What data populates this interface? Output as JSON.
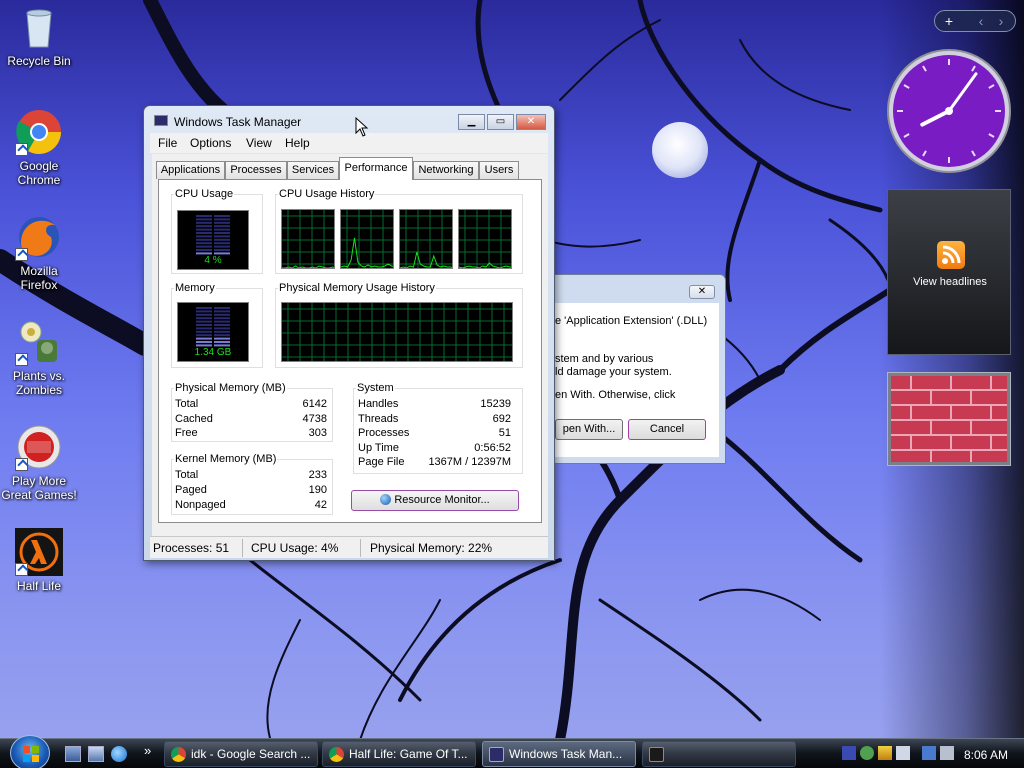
{
  "desktop": {
    "icons": [
      {
        "label": "Recycle Bin",
        "icon": "recycle-bin-icon"
      },
      {
        "label": "Google Chrome",
        "icon": "chrome-icon"
      },
      {
        "label": "Mozilla Firefox",
        "icon": "firefox-icon"
      },
      {
        "label": "Plants vs. Zombies",
        "icon": "plants-vs-zombies-icon"
      },
      {
        "label": "Play More Great Games!",
        "icon": "popcap-icon"
      },
      {
        "label": "Half Life",
        "icon": "half-life-icon"
      }
    ]
  },
  "sidebar": {
    "add_button": "+",
    "feed_label": "View headlines",
    "clock": {
      "hour": 8,
      "minute": 6
    }
  },
  "dialog": {
    "close_label": "✕",
    "line1": "e 'Application Extension' (.DLL)",
    "line2": "stem and by various",
    "line3": "ld damage your system.",
    "line4": "en With. Otherwise, click",
    "open_with_label": "pen With...",
    "cancel_label": "Cancel"
  },
  "task_manager": {
    "title": "Windows Task Manager",
    "window_buttons": {
      "minimize": "▁",
      "maximize": "▭",
      "close": "✕"
    },
    "menu": [
      "File",
      "Options",
      "View",
      "Help"
    ],
    "tabs": [
      "Applications",
      "Processes",
      "Services",
      "Performance",
      "Networking",
      "Users"
    ],
    "active_tab": "Performance",
    "cpu_usage_label": "CPU Usage",
    "cpu_usage_value": "4 %",
    "cpu_usage_pct": 4,
    "cpu_history_label": "CPU Usage History",
    "memory_label": "Memory",
    "memory_value": "1.34 GB",
    "memory_pct": 22,
    "memory_history_label": "Physical Memory Usage History",
    "physical_memory": {
      "title": "Physical Memory (MB)",
      "rows": [
        {
          "label": "Total",
          "value": "6142"
        },
        {
          "label": "Cached",
          "value": "4738"
        },
        {
          "label": "Free",
          "value": "303"
        }
      ]
    },
    "kernel_memory": {
      "title": "Kernel Memory (MB)",
      "rows": [
        {
          "label": "Total",
          "value": "233"
        },
        {
          "label": "Paged",
          "value": "190"
        },
        {
          "label": "Nonpaged",
          "value": "42"
        }
      ]
    },
    "system": {
      "title": "System",
      "rows": [
        {
          "label": "Handles",
          "value": "15239"
        },
        {
          "label": "Threads",
          "value": "692"
        },
        {
          "label": "Processes",
          "value": "51"
        },
        {
          "label": "Up Time",
          "value": "0:56:52"
        },
        {
          "label": "Page File",
          "value": "1367M / 12397M"
        }
      ]
    },
    "resource_monitor_label": "Resource Monitor...",
    "status": {
      "processes": "Processes: 51",
      "cpu": "CPU Usage: 4%",
      "memory": "Physical Memory: 22%"
    }
  },
  "taskbar": {
    "buttons": [
      {
        "label": "idk - Google Search ...",
        "icon": "chrome-icon"
      },
      {
        "label": "Half Life: Game Of T...",
        "icon": "chrome-icon"
      },
      {
        "label": "Windows Task Man...",
        "icon": "task-manager-icon"
      },
      {
        "label": "",
        "icon": "half-life-icon"
      }
    ],
    "overflow": "»",
    "time": "8:06 AM"
  },
  "colors": {
    "graph_green": "#18e018",
    "memory_line": "#3a7fe0",
    "wallpaper_blue": "#6f7cf0",
    "clock_purple": "#7a1cc4"
  }
}
